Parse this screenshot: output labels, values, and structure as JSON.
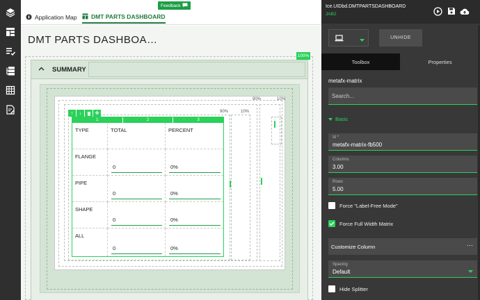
{
  "tabs": {
    "app_map": "Application Map",
    "dashboard": "DMT PARTS DASHBOARD"
  },
  "feedback": "Feedback",
  "canvas": {
    "page_title": "DMT PARTS DASHBOA…",
    "pct_100": "100%",
    "summary_label": "SUMMARY",
    "pct_90_outer": "90%",
    "pct_10_outer": "10%",
    "pct_90_inner": "90%",
    "pct_10_inner": "10%"
  },
  "matrix": {
    "col_numbers": [
      "1",
      "2",
      "3"
    ],
    "header_row": [
      "TYPE",
      "TOTAL",
      "PERCENT"
    ],
    "rows": [
      {
        "type": "FLANGE",
        "total": "0",
        "percent": "0%"
      },
      {
        "type": "PIPE",
        "total": "0",
        "percent": "0%"
      },
      {
        "type": "SHAPE",
        "total": "0",
        "percent": "0%"
      },
      {
        "type": "ALL",
        "total": "0",
        "percent": "0%"
      }
    ]
  },
  "panel": {
    "title": "Ice.UIDbd.DMTPARTSDASHBOARD",
    "subtitle": "JAB2",
    "unhide": "UNHIDE",
    "tab_toolbox": "Toolbox",
    "tab_properties": "Properties",
    "component_name": "metafx-matrix",
    "search_placeholder": "Search...",
    "section_basic": "Basic",
    "fields": [
      {
        "label": "Id *",
        "value": "metafx-matrix-fb500"
      },
      {
        "label": "Columns",
        "value": "3.00"
      },
      {
        "label": "Rows",
        "value": "5.00"
      }
    ],
    "force_label_free": "Force \"Label-Free Mode\"",
    "force_full_width": "Force Full Width Matrix",
    "customize_column": "Customize Column",
    "customize_dots": "···",
    "spacing_label": "Spacing",
    "spacing_value": "Default",
    "hide_splitter": "Hide Splitter"
  },
  "colors": {
    "accent": "#2bd15a",
    "brand_green": "#1e7b3a",
    "panel_bg": "#383838",
    "rail_bg": "#2f2f2f"
  },
  "state": {
    "force_label_free_checked": false,
    "force_full_width_checked": true,
    "hide_splitter_checked": false
  }
}
